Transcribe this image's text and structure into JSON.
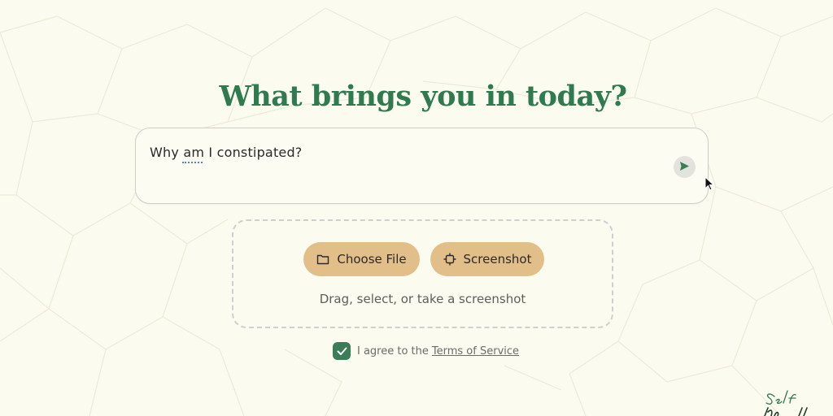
{
  "heading": "What brings you in today?",
  "prompt": {
    "value": "Why am I constipated?",
    "send_icon": "send-arrow-icon"
  },
  "upload": {
    "choose_file_label": "Choose File",
    "choose_file_icon": "folder-icon",
    "screenshot_label": "Screenshot",
    "screenshot_icon": "crop-icon",
    "hint": "Drag, select, or take a screenshot"
  },
  "terms": {
    "checked": true,
    "agree_text": "I agree to the",
    "link_text": "Terms of Service"
  },
  "colors": {
    "accent": "#2f7a4f",
    "checkbox": "#3a7d57",
    "button": "#e2bf88",
    "background": "#fcfbf0"
  }
}
